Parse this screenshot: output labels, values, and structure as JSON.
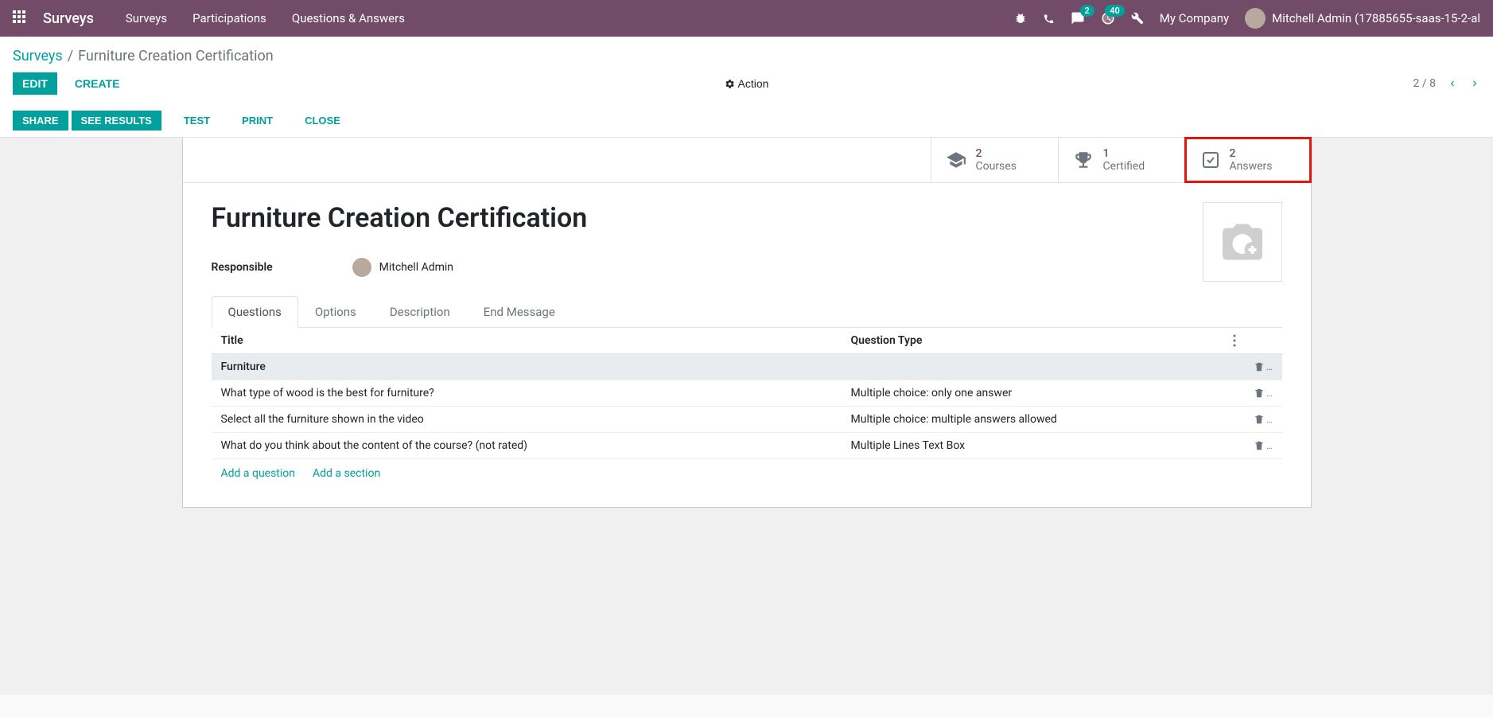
{
  "topbar": {
    "brand": "Surveys",
    "nav": [
      "Surveys",
      "Participations",
      "Questions & Answers"
    ],
    "messages_badge": "2",
    "activities_badge": "40",
    "company": "My Company",
    "user": "Mitchell Admin (17885655-saas-15-2-al"
  },
  "breadcrumb": {
    "root": "Surveys",
    "current": "Furniture Creation Certification"
  },
  "controls": {
    "edit": "EDIT",
    "create": "CREATE",
    "action": "Action",
    "pager": "2 / 8"
  },
  "status_buttons": {
    "share": "SHARE",
    "see_results": "SEE RESULTS",
    "test": "TEST",
    "print": "PRINT",
    "close": "CLOSE"
  },
  "stats": {
    "courses": {
      "num": "2",
      "label": "Courses"
    },
    "certified": {
      "num": "1",
      "label": "Certified"
    },
    "answers": {
      "num": "2",
      "label": "Answers"
    }
  },
  "record": {
    "title": "Furniture Creation Certification",
    "responsible_label": "Responsible",
    "responsible_value": "Mitchell Admin"
  },
  "tabs": [
    "Questions",
    "Options",
    "Description",
    "End Message"
  ],
  "table": {
    "th_title": "Title",
    "th_type": "Question Type",
    "rows": [
      {
        "title": "Furniture",
        "type": "",
        "section": true
      },
      {
        "title": "What type of wood is the best for furniture?",
        "type": "Multiple choice: only one answer",
        "section": false
      },
      {
        "title": "Select all the furniture shown in the video",
        "type": "Multiple choice: multiple answers allowed",
        "section": false
      },
      {
        "title": "What do you think about the content of the course? (not rated)",
        "type": "Multiple Lines Text Box",
        "section": false
      }
    ],
    "add_question": "Add a question",
    "add_section": "Add a section"
  }
}
